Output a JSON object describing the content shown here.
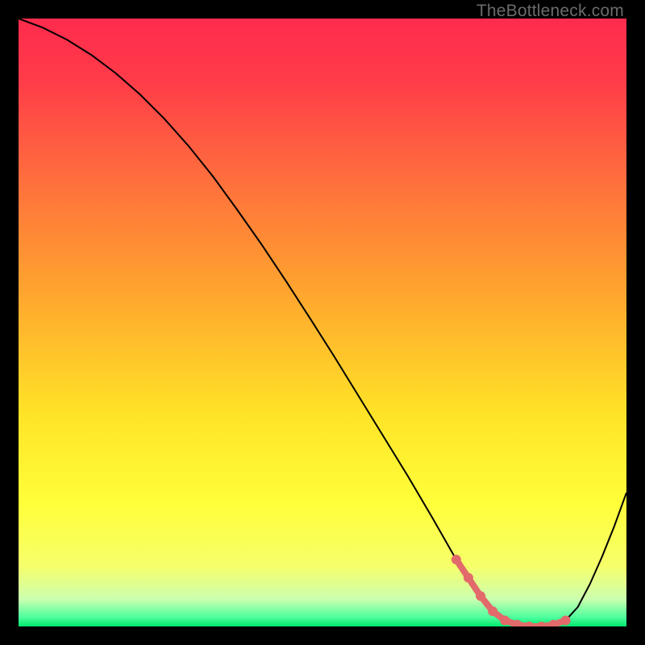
{
  "watermark": "TheBottleneck.com",
  "chart_data": {
    "type": "line",
    "title": "",
    "xlabel": "",
    "ylabel": "",
    "xlim": [
      0,
      100
    ],
    "ylim": [
      0,
      100
    ],
    "grid": false,
    "background_gradient_stops": [
      {
        "offset": 0.0,
        "color": "#ff2b4d"
      },
      {
        "offset": 0.1,
        "color": "#ff3b49"
      },
      {
        "offset": 0.25,
        "color": "#ff6a3e"
      },
      {
        "offset": 0.45,
        "color": "#ffa52e"
      },
      {
        "offset": 0.65,
        "color": "#ffe327"
      },
      {
        "offset": 0.8,
        "color": "#ffff3a"
      },
      {
        "offset": 0.9,
        "color": "#f6ff6a"
      },
      {
        "offset": 0.955,
        "color": "#ccffb0"
      },
      {
        "offset": 0.985,
        "color": "#4dff9e"
      },
      {
        "offset": 1.0,
        "color": "#00e86b"
      }
    ],
    "series": [
      {
        "name": "bottleneck-curve",
        "stroke": "#000000",
        "stroke_width": 2,
        "x": [
          0,
          4,
          8,
          12,
          16,
          20,
          24,
          28,
          32,
          36,
          40,
          44,
          48,
          52,
          56,
          60,
          64,
          68,
          72,
          74,
          76,
          78,
          80,
          82,
          84,
          86,
          88,
          90,
          92,
          94,
          96,
          98,
          100
        ],
        "y": [
          100,
          98.5,
          96.5,
          94,
          91,
          87.5,
          83.5,
          79,
          74,
          68.5,
          62.8,
          56.8,
          50.6,
          44.3,
          37.8,
          31.3,
          24.8,
          18,
          11,
          8,
          5,
          2.5,
          1,
          0.3,
          0,
          0,
          0.3,
          1,
          3.2,
          7,
          11.5,
          16.5,
          22
        ]
      },
      {
        "name": "highlight-zone",
        "stroke": "#e26a6a",
        "stroke_width": 8,
        "linecap": "round",
        "x": [
          72,
          74,
          76,
          78,
          80,
          82,
          84,
          86,
          88,
          90
        ],
        "y": [
          11,
          8,
          5,
          2.5,
          1,
          0.3,
          0,
          0,
          0.3,
          1
        ],
        "markers": {
          "shape": "circle",
          "radius": 6,
          "fill": "#e26a6a",
          "x": [
            72,
            74,
            76,
            78,
            80,
            82,
            84,
            86,
            88,
            90
          ],
          "y": [
            11,
            8,
            5,
            2.5,
            1,
            0.3,
            0,
            0,
            0.3,
            1
          ]
        }
      }
    ]
  }
}
